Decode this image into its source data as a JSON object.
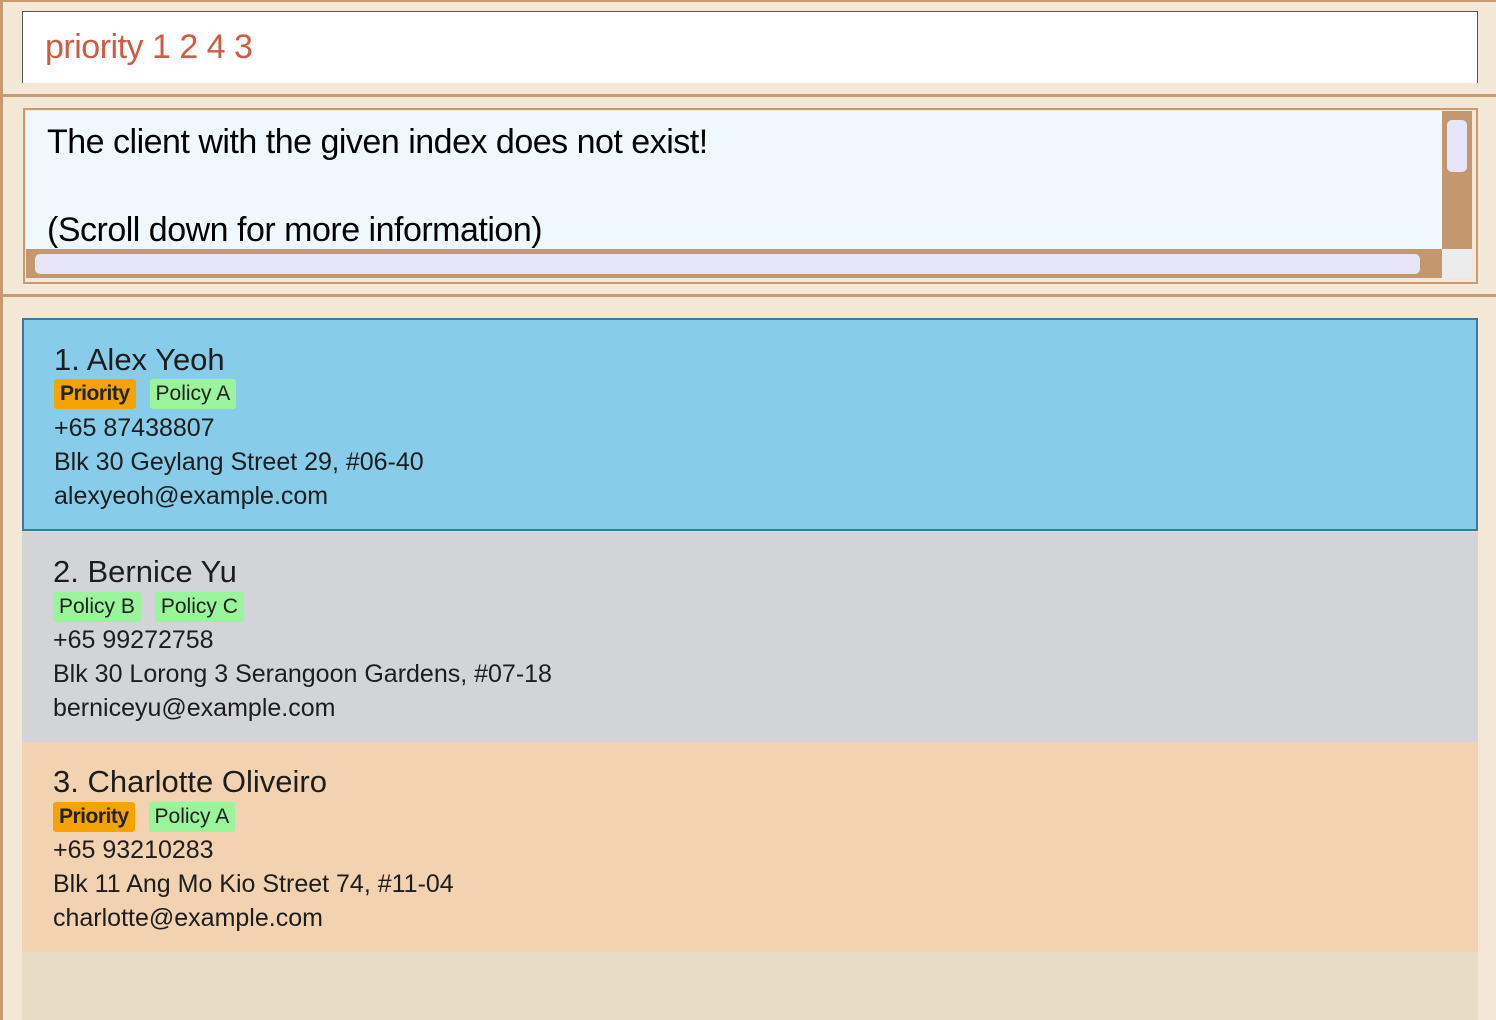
{
  "command_box": {
    "value": "priority 1 2 4 3"
  },
  "result_display": {
    "line1": "The client with the given index does not exist!",
    "line2": "(Scroll down for more information)"
  },
  "clients": [
    {
      "name": "1. Alex Yeoh",
      "tags": [
        "Priority",
        "Policy A"
      ],
      "phone": "+65 87438807",
      "address": "Blk 30 Geylang Street 29, #06-40",
      "email": "alexyeoh@example.com"
    },
    {
      "name": "2. Bernice Yu",
      "tags": [
        "Policy B",
        "Policy C"
      ],
      "phone": "+65 99272758",
      "address": "Blk 30 Lorong 3 Serangoon Gardens, #07-18",
      "email": "berniceyu@example.com"
    },
    {
      "name": "3. Charlotte Oliveiro",
      "tags": [
        "Priority",
        "Policy A"
      ],
      "phone": "+65 93210283",
      "address": "Blk 11 Ang Mo Kio Street 74, #11-04",
      "email": "charlotte@example.com"
    }
  ],
  "colors": {
    "selected_card": "#87cce9",
    "card_2": "#d3d4d8",
    "card_3": "#f2d2b1",
    "priority_tag": "#f5a300",
    "policy_tag": "#9af49a",
    "command_text": "#cd5c44"
  }
}
